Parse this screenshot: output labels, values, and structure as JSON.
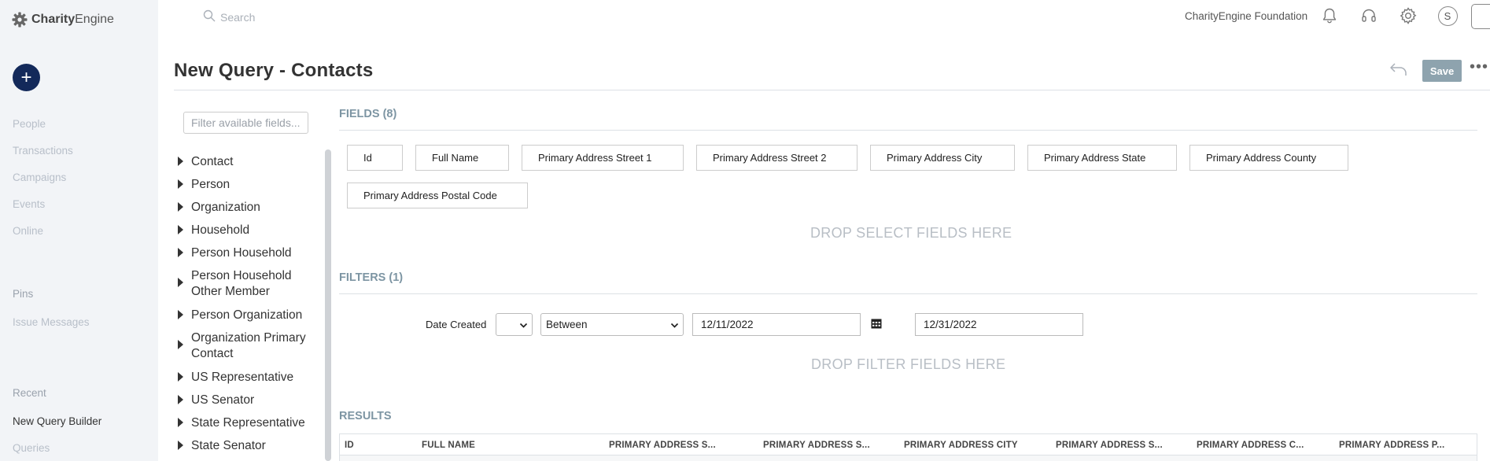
{
  "app": {
    "brand_name_bold": "Charity",
    "brand_name_rest": "Engine",
    "search_placeholder": "Search",
    "org_name": "CharityEngine Foundation",
    "avatar_initial": "S"
  },
  "left_nav": {
    "add_label": "+",
    "items": [
      "People",
      "Transactions",
      "Campaigns",
      "Events",
      "Online"
    ],
    "pins_label": "Pins",
    "issue_messages_label": "Issue Messages",
    "recent_label": "Recent",
    "recent_items": [
      "New Query Builder",
      "Queries"
    ]
  },
  "header": {
    "title": "New Query - Contacts",
    "save_label": "Save",
    "more_label": "•••"
  },
  "field_tree": {
    "filter_placeholder": "Filter available fields...",
    "items": [
      "Contact",
      "Person",
      "Organization",
      "Household",
      "Person Household",
      "Person Household Other Member",
      "Person Organization",
      "Organization Primary Contact",
      "US Representative",
      "US Senator",
      "State Representative",
      "State Senator"
    ]
  },
  "fields": {
    "title": "FIELDS (8)",
    "chips": [
      "Id",
      "Full Name",
      "Primary Address Street 1",
      "Primary Address Street 2",
      "Primary Address City",
      "Primary Address State",
      "Primary Address County",
      "Primary Address Postal Code"
    ],
    "drop_label": "DROP SELECT FIELDS HERE"
  },
  "filters": {
    "title": "FILTERS (1)",
    "field_label": "Date Created",
    "modifier_value": "",
    "operator_value": "Between",
    "from_value": "12/11/2022",
    "to_value": "12/31/2022",
    "drop_label": "DROP FILTER FIELDS HERE"
  },
  "results": {
    "title": "RESULTS",
    "columns": [
      "ID",
      "FULL NAME",
      "PRIMARY ADDRESS S...",
      "PRIMARY ADDRESS S...",
      "PRIMARY ADDRESS CITY",
      "PRIMARY ADDRESS S...",
      "PRIMARY ADDRESS C...",
      "PRIMARY ADDRESS P..."
    ]
  },
  "colors": {
    "nav_bg": "#f2f4f7",
    "add_button": "#13295a",
    "section_title": "#7d95a3",
    "save_button": "#8ea3ae"
  }
}
